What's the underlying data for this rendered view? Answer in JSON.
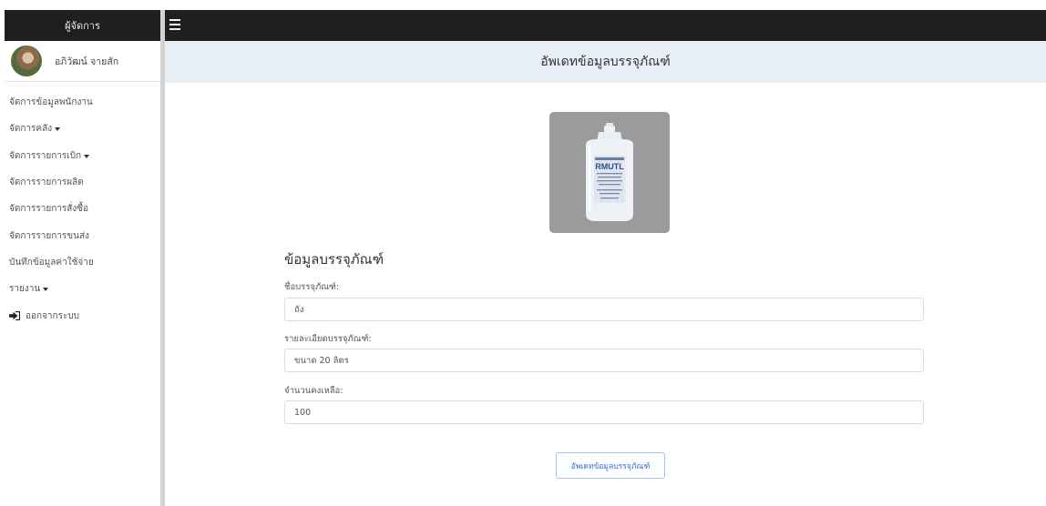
{
  "sidebar": {
    "header": "ผู้จัดการ",
    "user_name": "อภิวัฒน์ จายสัก",
    "items": [
      {
        "label": "จัดการข้อมูลพนักงาน"
      },
      {
        "label": "จัดการคลัง"
      },
      {
        "label": "จัดการรายการเบิก"
      },
      {
        "label": "จัดการรายการผลิต"
      },
      {
        "label": "จัดการรายการสั่งซื้อ"
      },
      {
        "label": "จัดการรายการขนส่ง"
      },
      {
        "label": "บันทึกข้อมูลค่าใช้จ่าย"
      },
      {
        "label": "รายงาน"
      },
      {
        "label": "ออกจากระบบ"
      }
    ]
  },
  "page": {
    "title": "อัพเดทข้อมูลบรรจุภัณฑ์"
  },
  "product_image": {
    "brand": "RMUTL"
  },
  "form": {
    "section_title": "ข้อมูลบรรจุภัณฑ์",
    "name_label": "ชื่อบรรจุภัณฑ์:",
    "name_value": "ถัง",
    "detail_label": "รายละเอียดบรรจุภัณฑ์:",
    "detail_value": "ขนาด 20 ลิตร",
    "stock_label": "จำนวนคงเหลือ:",
    "stock_value": "100",
    "submit_label": "อัพเดทข้อมูลบรรจุภัณฑ์"
  }
}
